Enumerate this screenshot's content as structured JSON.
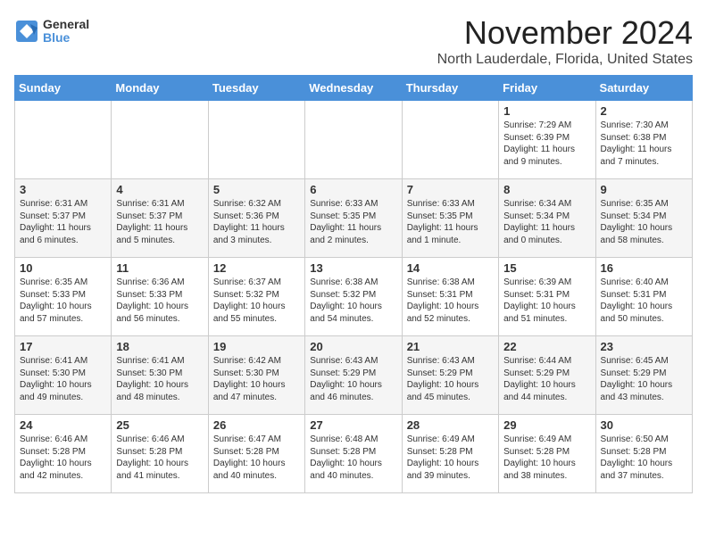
{
  "logo": {
    "general": "General",
    "blue": "Blue"
  },
  "title": "November 2024",
  "location": "North Lauderdale, Florida, United States",
  "weekdays": [
    "Sunday",
    "Monday",
    "Tuesday",
    "Wednesday",
    "Thursday",
    "Friday",
    "Saturday"
  ],
  "weeks": [
    [
      {
        "day": "",
        "info": ""
      },
      {
        "day": "",
        "info": ""
      },
      {
        "day": "",
        "info": ""
      },
      {
        "day": "",
        "info": ""
      },
      {
        "day": "",
        "info": ""
      },
      {
        "day": "1",
        "info": "Sunrise: 7:29 AM\nSunset: 6:39 PM\nDaylight: 11 hours and 9 minutes."
      },
      {
        "day": "2",
        "info": "Sunrise: 7:30 AM\nSunset: 6:38 PM\nDaylight: 11 hours and 7 minutes."
      }
    ],
    [
      {
        "day": "3",
        "info": "Sunrise: 6:31 AM\nSunset: 5:37 PM\nDaylight: 11 hours and 6 minutes."
      },
      {
        "day": "4",
        "info": "Sunrise: 6:31 AM\nSunset: 5:37 PM\nDaylight: 11 hours and 5 minutes."
      },
      {
        "day": "5",
        "info": "Sunrise: 6:32 AM\nSunset: 5:36 PM\nDaylight: 11 hours and 3 minutes."
      },
      {
        "day": "6",
        "info": "Sunrise: 6:33 AM\nSunset: 5:35 PM\nDaylight: 11 hours and 2 minutes."
      },
      {
        "day": "7",
        "info": "Sunrise: 6:33 AM\nSunset: 5:35 PM\nDaylight: 11 hours and 1 minute."
      },
      {
        "day": "8",
        "info": "Sunrise: 6:34 AM\nSunset: 5:34 PM\nDaylight: 11 hours and 0 minutes."
      },
      {
        "day": "9",
        "info": "Sunrise: 6:35 AM\nSunset: 5:34 PM\nDaylight: 10 hours and 58 minutes."
      }
    ],
    [
      {
        "day": "10",
        "info": "Sunrise: 6:35 AM\nSunset: 5:33 PM\nDaylight: 10 hours and 57 minutes."
      },
      {
        "day": "11",
        "info": "Sunrise: 6:36 AM\nSunset: 5:33 PM\nDaylight: 10 hours and 56 minutes."
      },
      {
        "day": "12",
        "info": "Sunrise: 6:37 AM\nSunset: 5:32 PM\nDaylight: 10 hours and 55 minutes."
      },
      {
        "day": "13",
        "info": "Sunrise: 6:38 AM\nSunset: 5:32 PM\nDaylight: 10 hours and 54 minutes."
      },
      {
        "day": "14",
        "info": "Sunrise: 6:38 AM\nSunset: 5:31 PM\nDaylight: 10 hours and 52 minutes."
      },
      {
        "day": "15",
        "info": "Sunrise: 6:39 AM\nSunset: 5:31 PM\nDaylight: 10 hours and 51 minutes."
      },
      {
        "day": "16",
        "info": "Sunrise: 6:40 AM\nSunset: 5:31 PM\nDaylight: 10 hours and 50 minutes."
      }
    ],
    [
      {
        "day": "17",
        "info": "Sunrise: 6:41 AM\nSunset: 5:30 PM\nDaylight: 10 hours and 49 minutes."
      },
      {
        "day": "18",
        "info": "Sunrise: 6:41 AM\nSunset: 5:30 PM\nDaylight: 10 hours and 48 minutes."
      },
      {
        "day": "19",
        "info": "Sunrise: 6:42 AM\nSunset: 5:30 PM\nDaylight: 10 hours and 47 minutes."
      },
      {
        "day": "20",
        "info": "Sunrise: 6:43 AM\nSunset: 5:29 PM\nDaylight: 10 hours and 46 minutes."
      },
      {
        "day": "21",
        "info": "Sunrise: 6:43 AM\nSunset: 5:29 PM\nDaylight: 10 hours and 45 minutes."
      },
      {
        "day": "22",
        "info": "Sunrise: 6:44 AM\nSunset: 5:29 PM\nDaylight: 10 hours and 44 minutes."
      },
      {
        "day": "23",
        "info": "Sunrise: 6:45 AM\nSunset: 5:29 PM\nDaylight: 10 hours and 43 minutes."
      }
    ],
    [
      {
        "day": "24",
        "info": "Sunrise: 6:46 AM\nSunset: 5:28 PM\nDaylight: 10 hours and 42 minutes."
      },
      {
        "day": "25",
        "info": "Sunrise: 6:46 AM\nSunset: 5:28 PM\nDaylight: 10 hours and 41 minutes."
      },
      {
        "day": "26",
        "info": "Sunrise: 6:47 AM\nSunset: 5:28 PM\nDaylight: 10 hours and 40 minutes."
      },
      {
        "day": "27",
        "info": "Sunrise: 6:48 AM\nSunset: 5:28 PM\nDaylight: 10 hours and 40 minutes."
      },
      {
        "day": "28",
        "info": "Sunrise: 6:49 AM\nSunset: 5:28 PM\nDaylight: 10 hours and 39 minutes."
      },
      {
        "day": "29",
        "info": "Sunrise: 6:49 AM\nSunset: 5:28 PM\nDaylight: 10 hours and 38 minutes."
      },
      {
        "day": "30",
        "info": "Sunrise: 6:50 AM\nSunset: 5:28 PM\nDaylight: 10 hours and 37 minutes."
      }
    ]
  ]
}
